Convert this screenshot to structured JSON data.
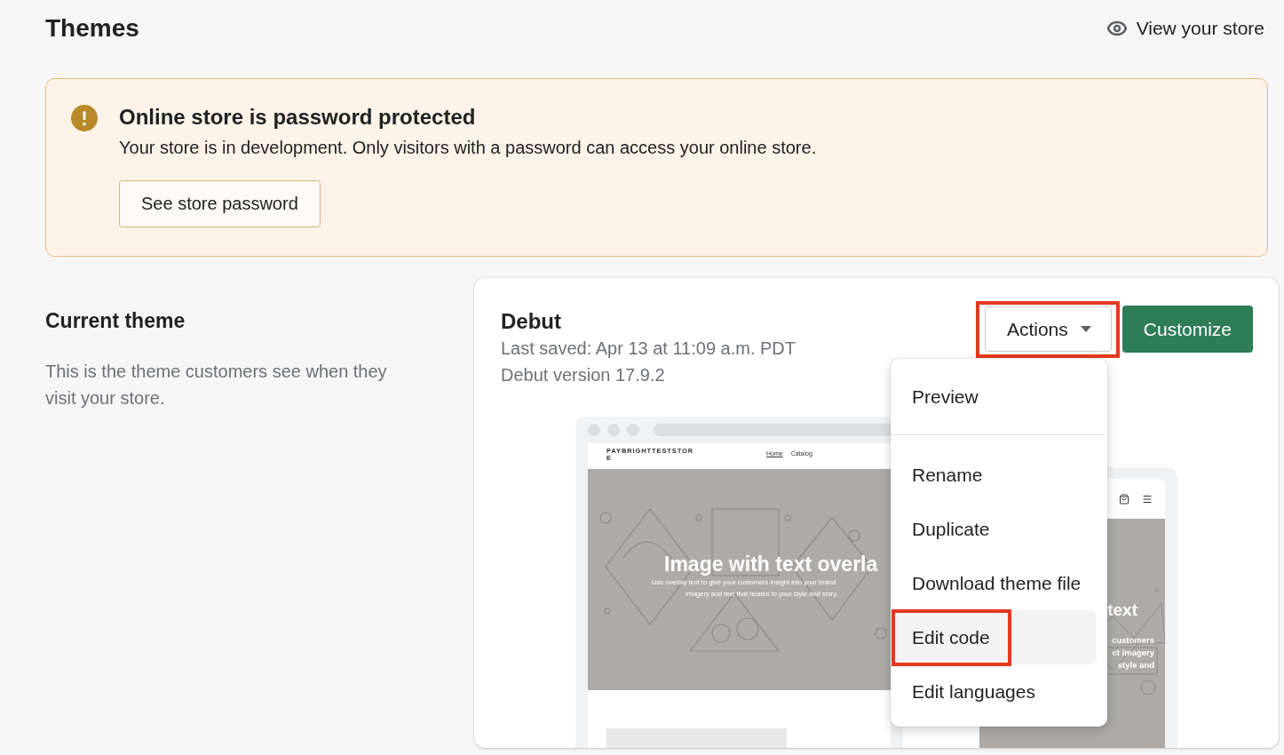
{
  "header": {
    "title": "Themes",
    "view_store_link": "View your store"
  },
  "banner": {
    "title": "Online store is password protected",
    "message": "Your store is in development. Only visitors with a password can access your online store.",
    "button": "See store password"
  },
  "current_theme": {
    "heading": "Current theme",
    "description": "This is the theme customers see when they visit your store."
  },
  "theme_card": {
    "name": "Debut",
    "last_saved": "Last saved: Apr 13 at 11:09 a.m. PDT",
    "version": "Debut version 17.9.2",
    "actions_button": {
      "label": "Actions",
      "highlighted": true
    },
    "customize_button": "Customize",
    "actions_menu": [
      {
        "items": [
          {
            "label": "Preview",
            "hovered": false,
            "highlighted": false
          }
        ]
      },
      {
        "items": [
          {
            "label": "Rename",
            "hovered": false,
            "highlighted": false
          },
          {
            "label": "Duplicate",
            "hovered": false,
            "highlighted": false
          },
          {
            "label": "Download theme file",
            "hovered": false,
            "highlighted": false
          },
          {
            "label": "Edit code",
            "hovered": true,
            "highlighted": true
          },
          {
            "label": "Edit languages",
            "hovered": false,
            "highlighted": false
          }
        ]
      }
    ],
    "preview": {
      "desktop": {
        "store_name": "PAYBRIGHTTESTSTORE",
        "nav": [
          {
            "label": "Home",
            "selected": true
          },
          {
            "label": "Catalog",
            "selected": false
          }
        ],
        "hero_title": "Image with text overla",
        "hero_lines": [
          "Use overlay text to give your customers insight into your brand",
          "imagery and text that relates to your style and story."
        ]
      },
      "mobile": {
        "hero_title": "text",
        "hero_lines": [
          "customers",
          "ct imagery",
          "style and"
        ]
      }
    }
  }
}
